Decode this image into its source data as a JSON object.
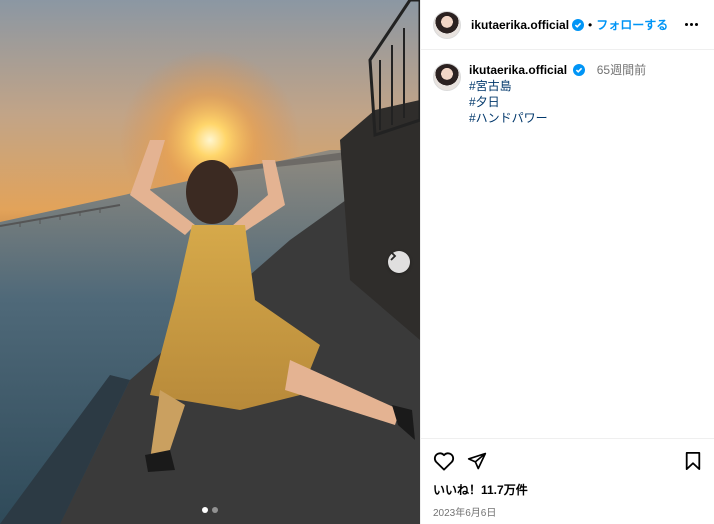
{
  "post": {
    "username": "ikutaerika.official",
    "follow_label": "フォローする",
    "separator": "•",
    "time_ago": "65週間前",
    "hashtags": [
      "#宮古島",
      "#夕日",
      "#ハンドパワー"
    ],
    "likes": "いいね！11.7万件",
    "date": "2023年6月6日"
  },
  "carousel": {
    "total_slides": 2,
    "current_slide": 1
  },
  "icons": {
    "verified": "verified-badge-icon",
    "more": "more-options-icon",
    "like": "heart-icon",
    "share": "paper-plane-icon",
    "save": "bookmark-icon",
    "next": "chevron-right-icon"
  },
  "colors": {
    "accent": "#0095f6",
    "hashtag": "#00376b",
    "muted": "#737373"
  }
}
